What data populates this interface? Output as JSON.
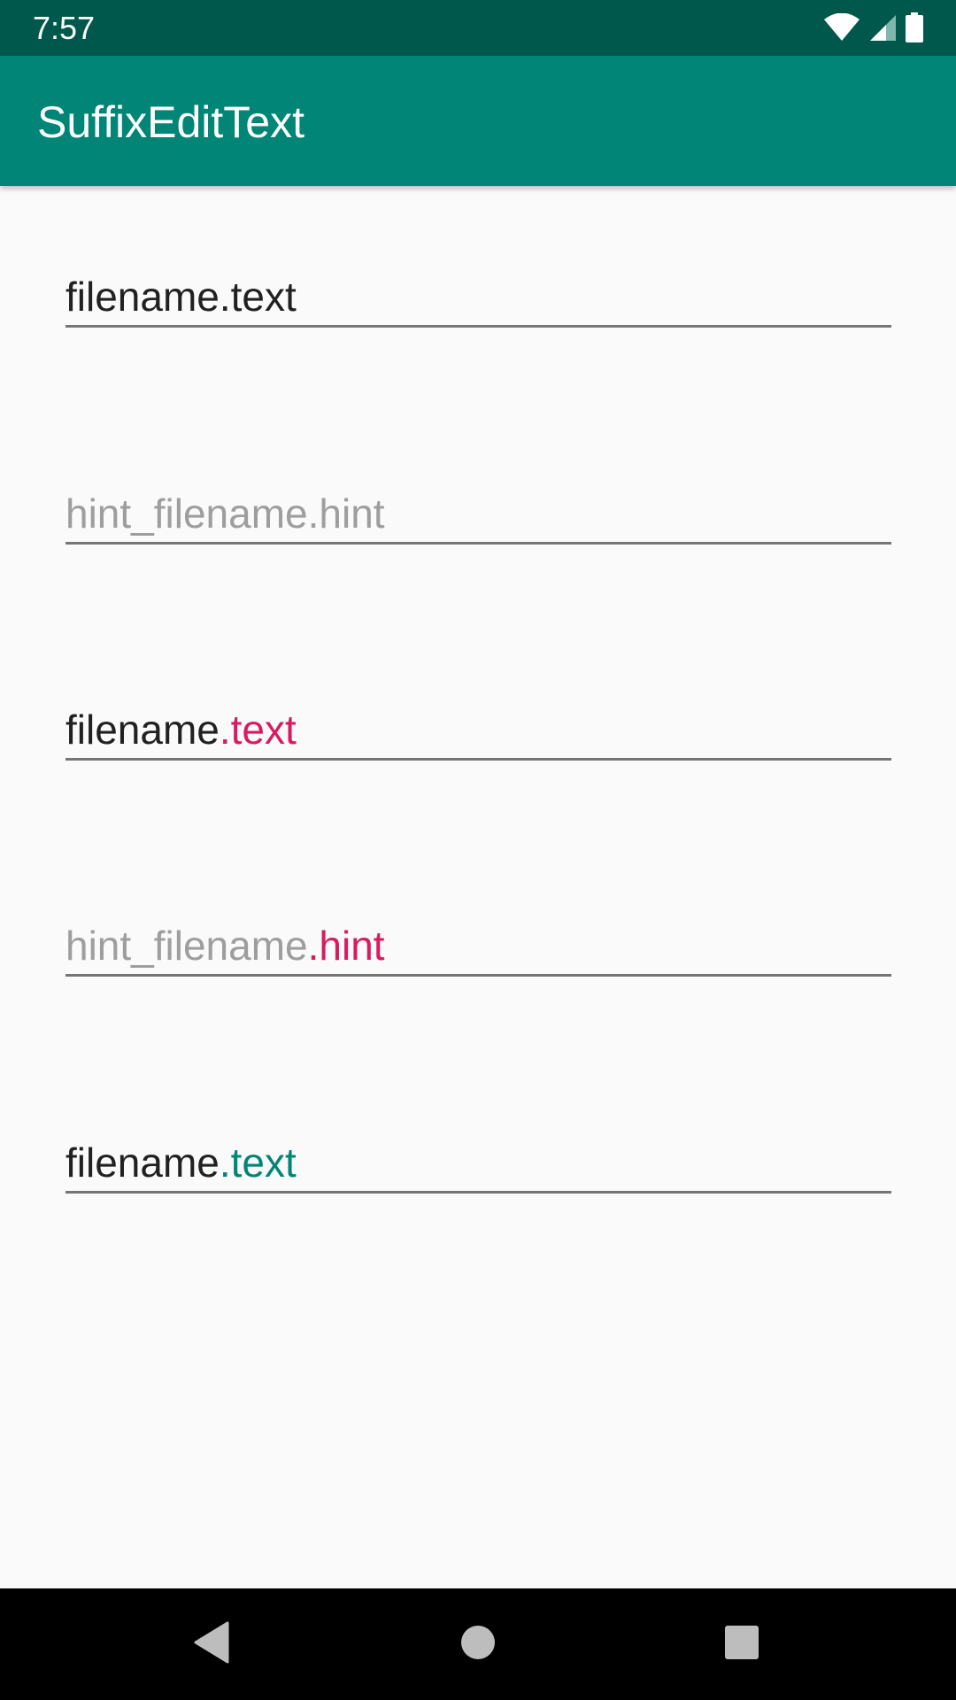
{
  "status_bar": {
    "time": "7:57",
    "icons": [
      "wifi-icon",
      "cell-signal-icon",
      "battery-icon"
    ]
  },
  "app_bar": {
    "title": "SuffixEditText"
  },
  "fields": [
    {
      "prefix": "filename",
      "suffix": ".text",
      "prefix_style": "text",
      "suffix_style": "text"
    },
    {
      "prefix": "hint_filename",
      "suffix": ".hint",
      "prefix_style": "hint",
      "suffix_style": "hint"
    },
    {
      "prefix": "filename",
      "suffix": ".text",
      "prefix_style": "text",
      "suffix_style": "pink"
    },
    {
      "prefix": "hint_filename",
      "suffix": ".hint",
      "prefix_style": "hint",
      "suffix_style": "pink"
    },
    {
      "prefix": "filename",
      "suffix": ".text",
      "prefix_style": "text",
      "suffix_style": "teal"
    }
  ],
  "colors": {
    "status_bar": "#00574b",
    "app_bar": "#008577",
    "text": "#212121",
    "hint": "#9e9e9e",
    "pink_suffix": "#d81b60",
    "teal_suffix": "#008577"
  },
  "nav_bar": {
    "buttons": [
      "back-icon",
      "home-icon",
      "recents-icon"
    ]
  }
}
